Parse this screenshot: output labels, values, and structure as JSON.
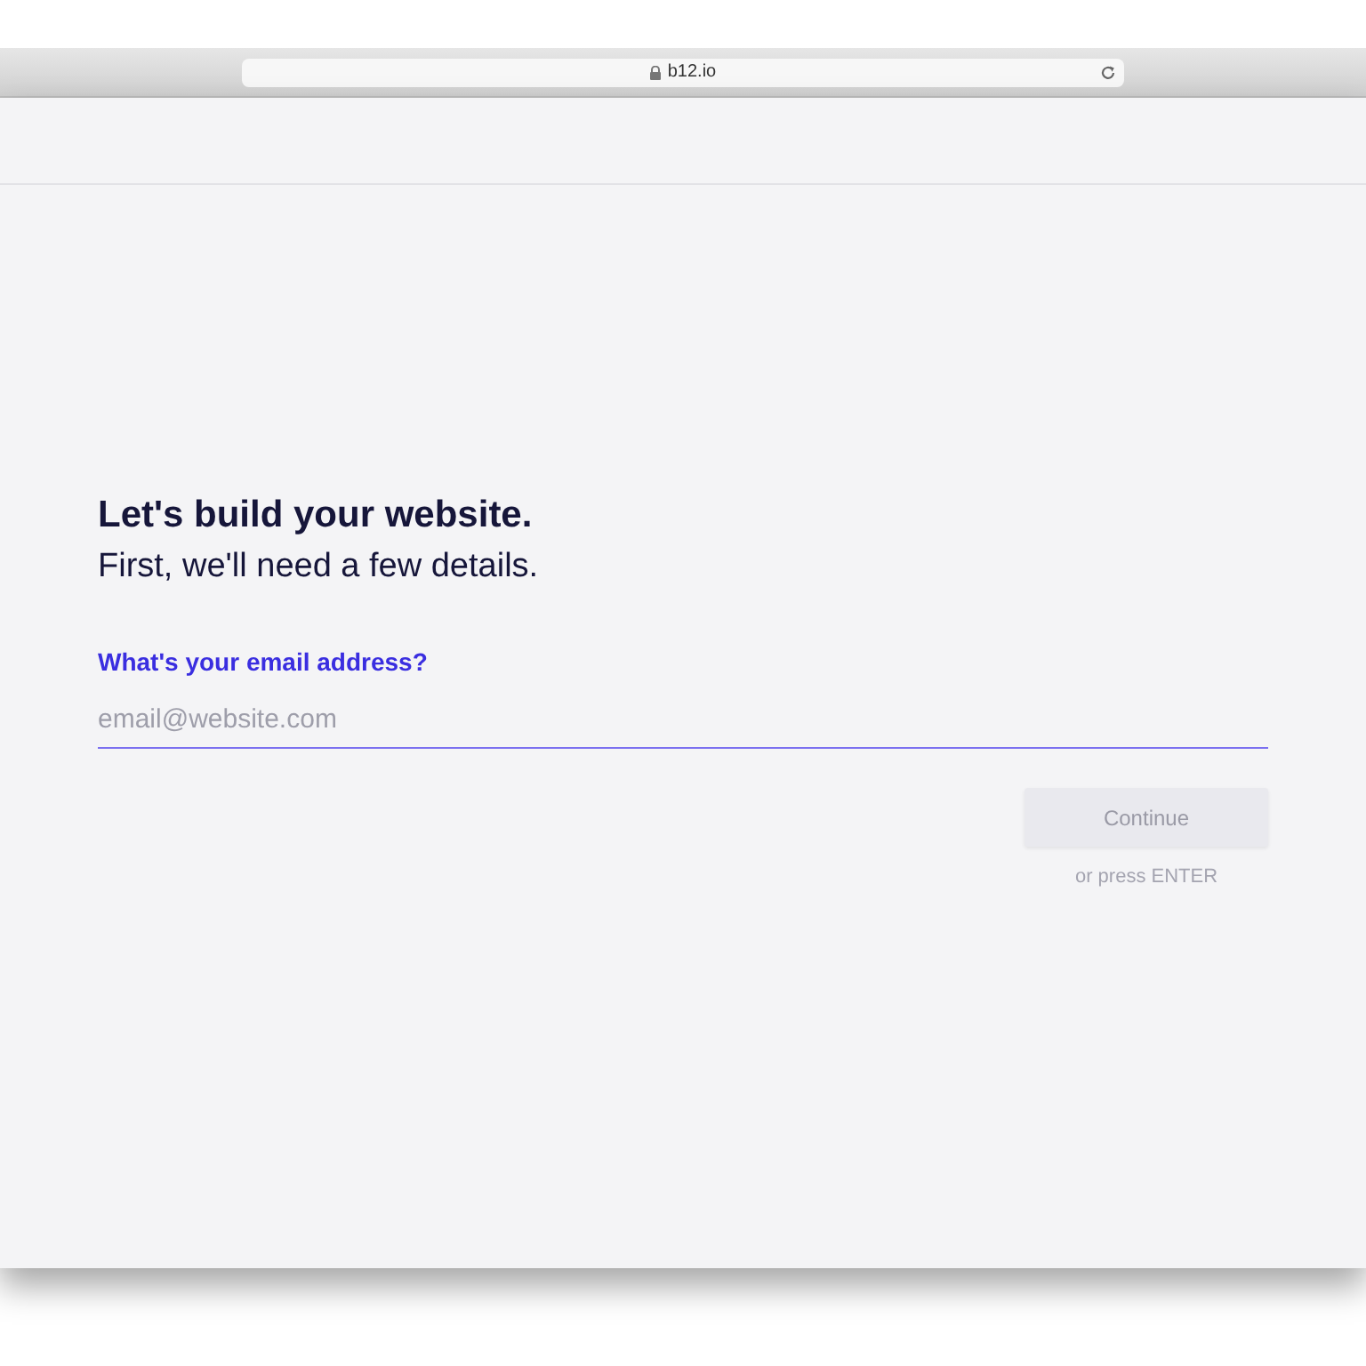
{
  "browser": {
    "url": "b12.io"
  },
  "heading": "Let's build your website.",
  "subheading": "First, we'll need a few details.",
  "email_field": {
    "label": "What's your email address?",
    "placeholder": "email@website.com"
  },
  "continue_button": {
    "label": "Continue",
    "disabled": true
  },
  "hint": "or press ENTER"
}
